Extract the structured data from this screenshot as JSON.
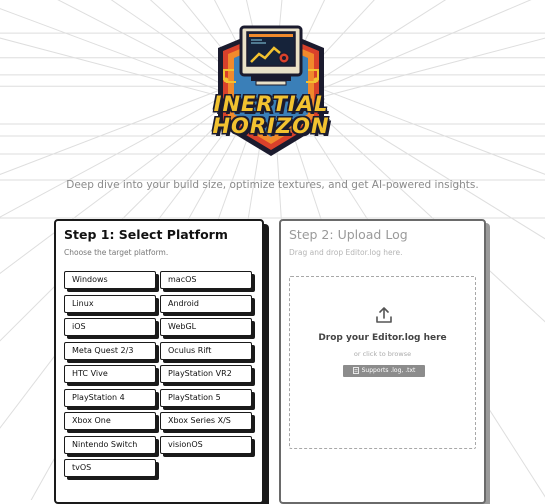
{
  "logo": {
    "title_line1": "INERTIAL",
    "title_line2": "HORIZON"
  },
  "tagline": "Deep dive into your build size, optimize textures, and get AI-powered insights.",
  "step1": {
    "title": "Step 1: Select Platform",
    "subtitle": "Choose the target platform.",
    "platforms": [
      "Windows",
      "macOS",
      "Linux",
      "Android",
      "iOS",
      "WebGL",
      "Meta Quest 2/3",
      "Oculus Rift",
      "HTC Vive",
      "PlayStation VR2",
      "PlayStation 4",
      "PlayStation 5",
      "Xbox One",
      "Xbox Series X/S",
      "Nintendo Switch",
      "visionOS",
      "tvOS"
    ]
  },
  "step2": {
    "title": "Step 2: Upload Log",
    "subtitle": "Drag and drop Editor.log here.",
    "drop_title": "Drop your Editor.log here",
    "drop_hint": "or click to browse",
    "badge": "Supports .log, .txt",
    "upload_icon": "upload-icon",
    "badge_icon": "file-icon"
  },
  "colors": {
    "border": "#1a1a1a",
    "muted_border": "#6a6a6a",
    "badge_bg": "#8c8c8c",
    "logo_yellow": "#f2c230",
    "logo_navy": "#1b1b2e"
  }
}
